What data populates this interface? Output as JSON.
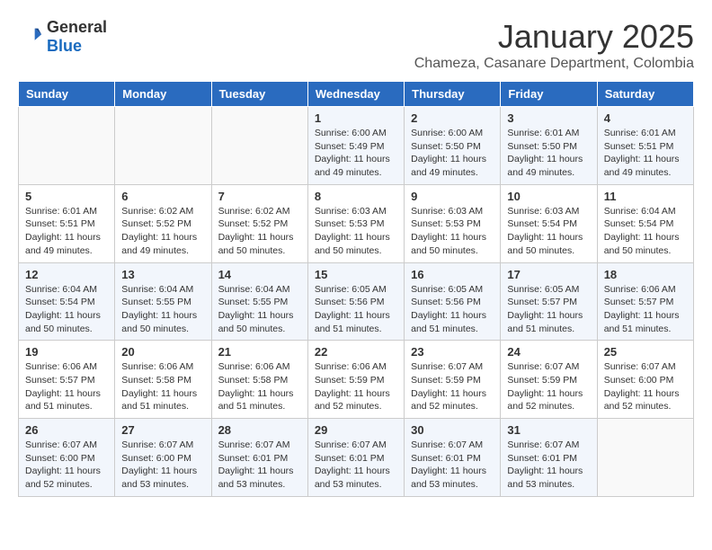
{
  "logo": {
    "general": "General",
    "blue": "Blue"
  },
  "header": {
    "month": "January 2025",
    "location": "Chameza, Casanare Department, Colombia"
  },
  "days_of_week": [
    "Sunday",
    "Monday",
    "Tuesday",
    "Wednesday",
    "Thursday",
    "Friday",
    "Saturday"
  ],
  "weeks": [
    [
      {
        "day": "",
        "content": ""
      },
      {
        "day": "",
        "content": ""
      },
      {
        "day": "",
        "content": ""
      },
      {
        "day": "1",
        "content": "Sunrise: 6:00 AM\nSunset: 5:49 PM\nDaylight: 11 hours\nand 49 minutes."
      },
      {
        "day": "2",
        "content": "Sunrise: 6:00 AM\nSunset: 5:50 PM\nDaylight: 11 hours\nand 49 minutes."
      },
      {
        "day": "3",
        "content": "Sunrise: 6:01 AM\nSunset: 5:50 PM\nDaylight: 11 hours\nand 49 minutes."
      },
      {
        "day": "4",
        "content": "Sunrise: 6:01 AM\nSunset: 5:51 PM\nDaylight: 11 hours\nand 49 minutes."
      }
    ],
    [
      {
        "day": "5",
        "content": "Sunrise: 6:01 AM\nSunset: 5:51 PM\nDaylight: 11 hours\nand 49 minutes."
      },
      {
        "day": "6",
        "content": "Sunrise: 6:02 AM\nSunset: 5:52 PM\nDaylight: 11 hours\nand 49 minutes."
      },
      {
        "day": "7",
        "content": "Sunrise: 6:02 AM\nSunset: 5:52 PM\nDaylight: 11 hours\nand 50 minutes."
      },
      {
        "day": "8",
        "content": "Sunrise: 6:03 AM\nSunset: 5:53 PM\nDaylight: 11 hours\nand 50 minutes."
      },
      {
        "day": "9",
        "content": "Sunrise: 6:03 AM\nSunset: 5:53 PM\nDaylight: 11 hours\nand 50 minutes."
      },
      {
        "day": "10",
        "content": "Sunrise: 6:03 AM\nSunset: 5:54 PM\nDaylight: 11 hours\nand 50 minutes."
      },
      {
        "day": "11",
        "content": "Sunrise: 6:04 AM\nSunset: 5:54 PM\nDaylight: 11 hours\nand 50 minutes."
      }
    ],
    [
      {
        "day": "12",
        "content": "Sunrise: 6:04 AM\nSunset: 5:54 PM\nDaylight: 11 hours\nand 50 minutes."
      },
      {
        "day": "13",
        "content": "Sunrise: 6:04 AM\nSunset: 5:55 PM\nDaylight: 11 hours\nand 50 minutes."
      },
      {
        "day": "14",
        "content": "Sunrise: 6:04 AM\nSunset: 5:55 PM\nDaylight: 11 hours\nand 50 minutes."
      },
      {
        "day": "15",
        "content": "Sunrise: 6:05 AM\nSunset: 5:56 PM\nDaylight: 11 hours\nand 51 minutes."
      },
      {
        "day": "16",
        "content": "Sunrise: 6:05 AM\nSunset: 5:56 PM\nDaylight: 11 hours\nand 51 minutes."
      },
      {
        "day": "17",
        "content": "Sunrise: 6:05 AM\nSunset: 5:57 PM\nDaylight: 11 hours\nand 51 minutes."
      },
      {
        "day": "18",
        "content": "Sunrise: 6:06 AM\nSunset: 5:57 PM\nDaylight: 11 hours\nand 51 minutes."
      }
    ],
    [
      {
        "day": "19",
        "content": "Sunrise: 6:06 AM\nSunset: 5:57 PM\nDaylight: 11 hours\nand 51 minutes."
      },
      {
        "day": "20",
        "content": "Sunrise: 6:06 AM\nSunset: 5:58 PM\nDaylight: 11 hours\nand 51 minutes."
      },
      {
        "day": "21",
        "content": "Sunrise: 6:06 AM\nSunset: 5:58 PM\nDaylight: 11 hours\nand 51 minutes."
      },
      {
        "day": "22",
        "content": "Sunrise: 6:06 AM\nSunset: 5:59 PM\nDaylight: 11 hours\nand 52 minutes."
      },
      {
        "day": "23",
        "content": "Sunrise: 6:07 AM\nSunset: 5:59 PM\nDaylight: 11 hours\nand 52 minutes."
      },
      {
        "day": "24",
        "content": "Sunrise: 6:07 AM\nSunset: 5:59 PM\nDaylight: 11 hours\nand 52 minutes."
      },
      {
        "day": "25",
        "content": "Sunrise: 6:07 AM\nSunset: 6:00 PM\nDaylight: 11 hours\nand 52 minutes."
      }
    ],
    [
      {
        "day": "26",
        "content": "Sunrise: 6:07 AM\nSunset: 6:00 PM\nDaylight: 11 hours\nand 52 minutes."
      },
      {
        "day": "27",
        "content": "Sunrise: 6:07 AM\nSunset: 6:00 PM\nDaylight: 11 hours\nand 53 minutes."
      },
      {
        "day": "28",
        "content": "Sunrise: 6:07 AM\nSunset: 6:01 PM\nDaylight: 11 hours\nand 53 minutes."
      },
      {
        "day": "29",
        "content": "Sunrise: 6:07 AM\nSunset: 6:01 PM\nDaylight: 11 hours\nand 53 minutes."
      },
      {
        "day": "30",
        "content": "Sunrise: 6:07 AM\nSunset: 6:01 PM\nDaylight: 11 hours\nand 53 minutes."
      },
      {
        "day": "31",
        "content": "Sunrise: 6:07 AM\nSunset: 6:01 PM\nDaylight: 11 hours\nand 53 minutes."
      },
      {
        "day": "",
        "content": ""
      }
    ]
  ]
}
